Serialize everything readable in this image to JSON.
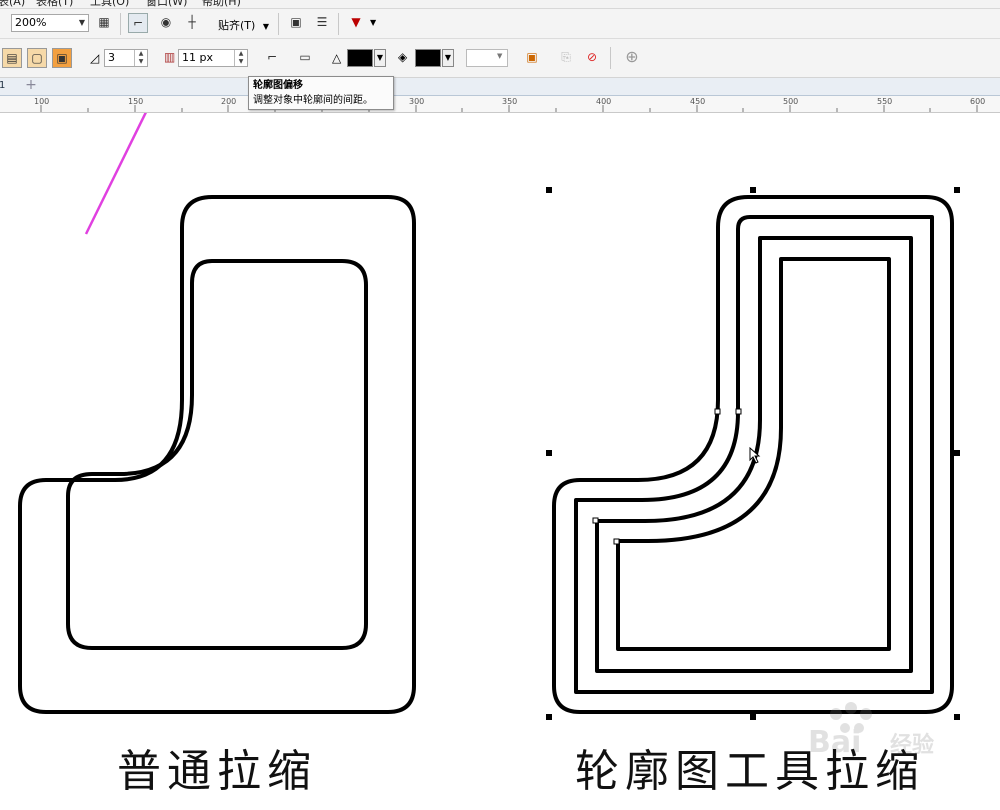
{
  "menu": [
    "表(A)",
    "表格(T)",
    "工具(O)",
    "窗口(W)",
    "帮助(H)"
  ],
  "toolbar": {
    "zoom": "200%",
    "snap_label": "贴齐(T)"
  },
  "property_bar": {
    "steps_value": "3",
    "offset_value": "11 px"
  },
  "tooltip": {
    "title": "轮廓图偏移",
    "description": "调整对象中轮廓间的间距。"
  },
  "page_tab": "1",
  "ruler_labels": [
    "100",
    "150",
    "200",
    "250",
    "300",
    "350",
    "400",
    "450",
    "500",
    "550",
    "600"
  ],
  "captions": {
    "left": "普通拉缩",
    "right": "轮廓图工具拉缩"
  },
  "colors": {
    "highlight": "#e040e0",
    "outline": "#000000",
    "fill_swatch": "#000000"
  },
  "icons": {
    "eye": "◉",
    "plus": "⊕",
    "add_tab": "+"
  }
}
